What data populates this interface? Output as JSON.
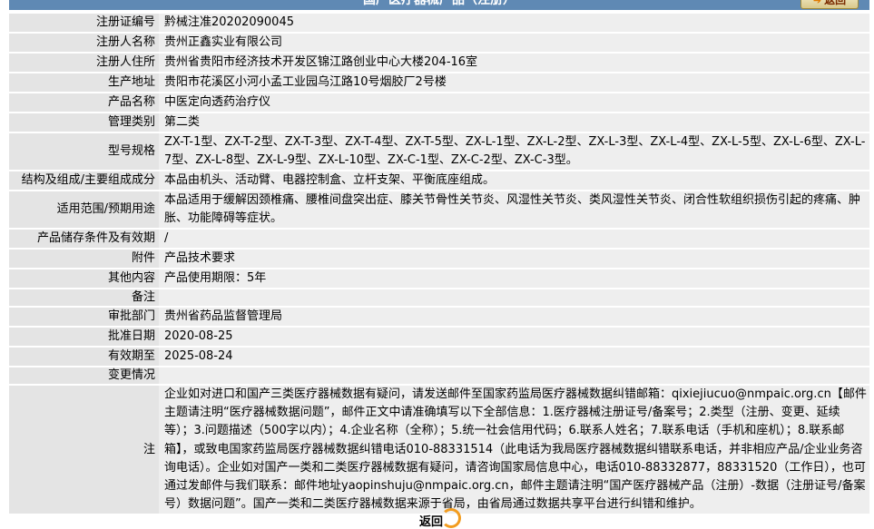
{
  "header": {
    "title": "国产医疗器械产品（注册）",
    "back_label": "返回"
  },
  "fields": [
    {
      "label": "注册证编号",
      "value": "黔械注准20202090045"
    },
    {
      "label": "注册人名称",
      "value": "贵州正鑫实业有限公司"
    },
    {
      "label": "注册人住所",
      "value": "贵州省贵阳市经济技术开发区锦江路创业中心大楼204-16室"
    },
    {
      "label": "生产地址",
      "value": "贵阳市花溪区小河小孟工业园乌江路10号烟胶厂2号楼"
    },
    {
      "label": "产品名称",
      "value": "中医定向透药治疗仪"
    },
    {
      "label": "管理类别",
      "value": "第二类"
    },
    {
      "label": "型号规格",
      "value": "ZX-T-1型、ZX-T-2型、ZX-T-3型、ZX-T-4型、ZX-T-5型、ZX-L-1型、ZX-L-2型、ZX-L-3型、ZX-L-4型、ZX-L-5型、ZX-L-6型、ZX-L-7型、ZX-L-8型、ZX-L-9型、ZX-L-10型、ZX-C-1型、ZX-C-2型、ZX-C-3型。"
    },
    {
      "label": "结构及组成/主要组成成分",
      "value": "本品由机头、活动臂、电器控制盒、立杆支架、平衡底座组成。"
    },
    {
      "label": "适用范围/预期用途",
      "value": "本品适用于缓解因颈椎痛、腰椎间盘突出症、膝关节骨性关节炎、风湿性关节炎、类风湿性关节炎、闭合性软组织损伤引起的疼痛、肿胀、功能障碍等症状。"
    },
    {
      "label": "产品储存条件及有效期",
      "value": "/"
    },
    {
      "label": "附件",
      "value": "产品技术要求"
    },
    {
      "label": "其他内容",
      "value": "产品使用期限：5年"
    },
    {
      "label": "备注",
      "value": ""
    },
    {
      "label": "审批部门",
      "value": "贵州省药品监督管理局"
    },
    {
      "label": "批准日期",
      "value": "2020-08-25"
    },
    {
      "label": "有效期至",
      "value": "2025-08-24"
    },
    {
      "label": "变更情况",
      "value": ""
    }
  ],
  "note": {
    "label": "注",
    "text": "企业如对进口和国产三类医疗器械数据有疑问，请发送邮件至国家药监局医疗器械数据纠错邮箱：qixiejiucuo@nmpaic.org.cn【邮件主题请注明“医疗器械数据问题”，邮件正文中请准确填写以下全部信息：1.医疗器械注册证号/备案号；2.类型（注册、变更、延续等）；3.问题描述（500字以内）；4.企业名称（全称）；5.统一社会信用代码；6.联系人姓名；7.联系电话（手机和座机）；8.联系邮箱】，或致电国家药监局医疗器械数据纠错电话010-88331514（此电话为我局医疗器械数据纠错联系电话，并非相应产品/企业业务咨询电话）。企业如对国产一类和二类医疗器械数据有疑问，请咨询国家局信息中心，电话010-88332877，88331520（工作日），也可通过发邮件与我们联系：邮件地址yaopinshuju@nmpaic.org.cn，邮件主题请注明“国产医疗器械产品（注册）-数据（注册证号/备案号）数据问题”。国产一类和二类医疗器械数据来源于省局，由省局通过数据共享平台进行纠错和维护。"
  },
  "footer": {
    "back_label": "返回"
  },
  "colors": {
    "header_bg": "#5f89b4",
    "label_bg": "#e4e4e4",
    "value_bg": "#eeeeee",
    "accent": "#f29c1f"
  }
}
